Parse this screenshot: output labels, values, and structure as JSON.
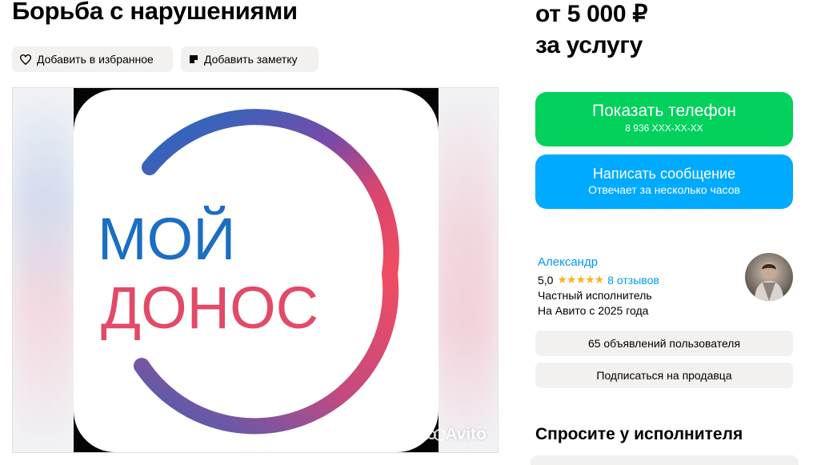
{
  "listing": {
    "title": "Борьба с нарушениями",
    "favorite_label": "Добавить в избранное",
    "note_label": "Добавить заметку"
  },
  "gallery": {
    "logo_line1": "МОЙ",
    "logo_line2": "ДОНОС",
    "watermark": "Avito"
  },
  "price": {
    "line1": "от 5 000 ₽",
    "line2": "за услугу"
  },
  "actions": {
    "phone_label": "Показать телефон",
    "phone_number": "8 936 XXX-XX-XX",
    "message_label": "Написать сообщение",
    "message_sub": "Отвечает за несколько часов"
  },
  "seller": {
    "name": "Александр",
    "rating": "5,0",
    "stars": "★★★★★",
    "reviews": "8 отзывов",
    "type": "Частный исполнитель",
    "since": "На Авито с 2025 года",
    "listings_button": "65 объявлений пользователя",
    "subscribe_button": "Подписаться на продавца"
  },
  "ask": {
    "title": "Спросите у исполнителя"
  },
  "colors": {
    "phone_button": "#02d15c",
    "message_button": "#00aaff",
    "link": "#0099f7",
    "star": "#ffb021",
    "logo_blue": "#1b6ec2",
    "logo_red": "#e24a68"
  }
}
